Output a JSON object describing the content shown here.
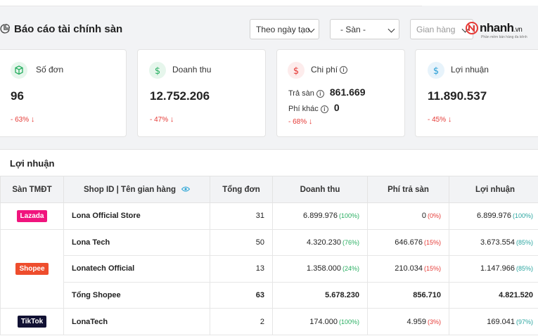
{
  "header": {
    "title": "Báo cáo tài chính sàn",
    "filters": {
      "date_filter": "Theo ngày tạo",
      "platform_filter": "- Sàn -",
      "shop_filter": "Gian hàng"
    },
    "logo": {
      "name": "nhanh",
      "suffix": ".vn",
      "slogan": "Phần mềm bán hàng đa kênh"
    }
  },
  "cards": {
    "orders": {
      "title": "Số đơn",
      "value": "96",
      "change": "- 63%",
      "icon": "cube-icon",
      "accent": "#27ae60"
    },
    "revenue": {
      "title": "Doanh thu",
      "value": "12.752.206",
      "change": "- 47%",
      "icon": "dollar-icon",
      "accent": "#27ae60"
    },
    "cost": {
      "title": "Chi phí",
      "platform_fee_label": "Trả sàn",
      "platform_fee_value": "861.669",
      "other_fee_label": "Phí khác",
      "other_fee_value": "0",
      "change": "- 68%",
      "icon": "dollar-icon",
      "accent": "#e53935"
    },
    "profit": {
      "title": "Lợi nhuận",
      "value": "11.890.537",
      "change": "- 45%",
      "icon": "dollar-icon",
      "accent": "#2a9fd6"
    }
  },
  "profit_table": {
    "title": "Lợi nhuận",
    "columns": [
      "Sàn TMĐT",
      "Shop ID | Tên gian hàng",
      "Tổng đơn",
      "Doanh thu",
      "Phí trả sàn",
      "Lợi nhuận"
    ],
    "platforms": {
      "lazada": {
        "label": "Lazada",
        "color": "#f0147d"
      },
      "shopee": {
        "label": "Shopee",
        "color": "#ee4d2d"
      },
      "tiktok": {
        "label": "TikTok",
        "color": "#111133"
      }
    },
    "rows": [
      {
        "shop": "Lona Official Store",
        "orders": "31",
        "revenue": "6.899.976",
        "revenue_pct": "(100%)",
        "fee": "0",
        "fee_pct": "(0%)",
        "profit": "6.899.976",
        "profit_pct": "(100%)"
      },
      {
        "shop": "Lona Tech",
        "orders": "50",
        "revenue": "4.320.230",
        "revenue_pct": "(76%)",
        "fee": "646.676",
        "fee_pct": "(15%)",
        "profit": "3.673.554",
        "profit_pct": "(85%)"
      },
      {
        "shop": "Lonatech Official",
        "orders": "13",
        "revenue": "1.358.000",
        "revenue_pct": "(24%)",
        "fee": "210.034",
        "fee_pct": "(15%)",
        "profit": "1.147.966",
        "profit_pct": "(85%)"
      },
      {
        "shop": "Tổng Shopee",
        "orders": "63",
        "revenue": "5.678.230",
        "fee": "856.710",
        "profit": "4.821.520"
      },
      {
        "shop": "LonaTech",
        "orders": "2",
        "revenue": "174.000",
        "revenue_pct": "(100%)",
        "fee": "4.959",
        "fee_pct": "(3%)",
        "profit": "169.041",
        "profit_pct": "(97%)"
      }
    ]
  }
}
